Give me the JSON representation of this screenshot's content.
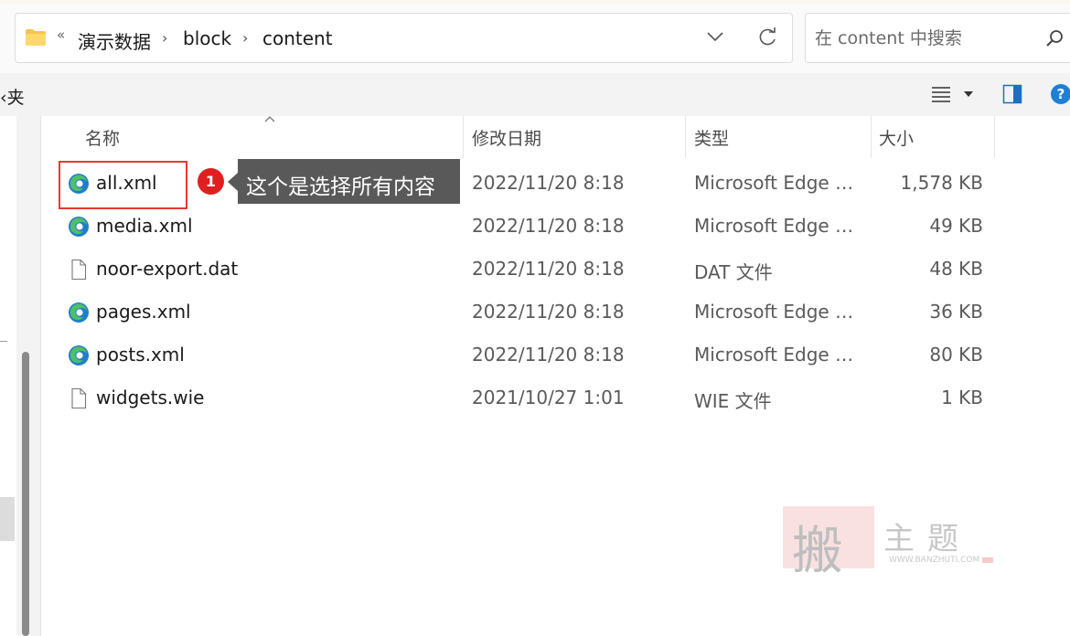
{
  "address_bar": {
    "overflow": "«",
    "breadcrumbs": [
      "演示数据",
      "block",
      "content"
    ],
    "separator": "›"
  },
  "search": {
    "placeholder": "在 content 中搜索"
  },
  "command_bar": {
    "partial_label": "‹夹"
  },
  "columns": {
    "name": "名称",
    "date": "修改日期",
    "type": "类型",
    "size": "大小"
  },
  "files": [
    {
      "name": "all.xml",
      "date": "2022/11/20 8:18",
      "type": "Microsoft Edge HTML Document",
      "size": "1,578 KB",
      "icon": "edge-icon"
    },
    {
      "name": "media.xml",
      "date": "2022/11/20 8:18",
      "type": "Microsoft Edge HTML Document",
      "size": "49 KB",
      "icon": "edge-icon"
    },
    {
      "name": "noor-export.dat",
      "date": "2022/11/20 8:18",
      "type": "DAT 文件",
      "size": "48 KB",
      "icon": "file-icon"
    },
    {
      "name": "pages.xml",
      "date": "2022/11/20 8:18",
      "type": "Microsoft Edge HTML Document",
      "size": "36 KB",
      "icon": "edge-icon"
    },
    {
      "name": "posts.xml",
      "date": "2022/11/20 8:18",
      "type": "Microsoft Edge HTML Document",
      "size": "80 KB",
      "icon": "edge-icon"
    },
    {
      "name": "widgets.wie",
      "date": "2021/10/27 1:01",
      "type": "WIE 文件",
      "size": "1 KB",
      "icon": "file-icon"
    }
  ],
  "annotation": {
    "step": "1",
    "text": "这个是选择所有内容"
  },
  "watermark": {
    "char": "搬",
    "title": "主题",
    "url": "WWW.BANZHUTI.COM"
  },
  "colors": {
    "highlight": "#e53935",
    "callout_bg": "#595959",
    "badge": "#e02020",
    "folder": "#f4c54e",
    "edge_blue": "#1e7fc9",
    "edge_green": "#4fbf6a"
  }
}
